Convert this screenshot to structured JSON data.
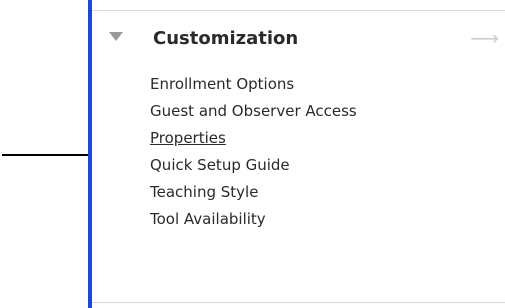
{
  "section": {
    "title": "Customization",
    "expanded": true,
    "expand_icon": "triangle-down-icon",
    "action_icon": "arrow-right-icon"
  },
  "menu": {
    "items": [
      {
        "label": "Enrollment Options"
      },
      {
        "label": "Guest and Observer Access"
      },
      {
        "label": "Properties",
        "highlighted": true
      },
      {
        "label": "Quick Setup Guide"
      },
      {
        "label": "Teaching Style"
      },
      {
        "label": "Tool Availability"
      }
    ]
  },
  "annotation": {
    "pointer_icon": "callout-arrow",
    "points_to": "Properties"
  },
  "colors": {
    "rail": "#1f47d6",
    "text": "#2a2a2a",
    "triangle": "#9a9a9a",
    "arrow_muted": "#d0d0d0"
  }
}
